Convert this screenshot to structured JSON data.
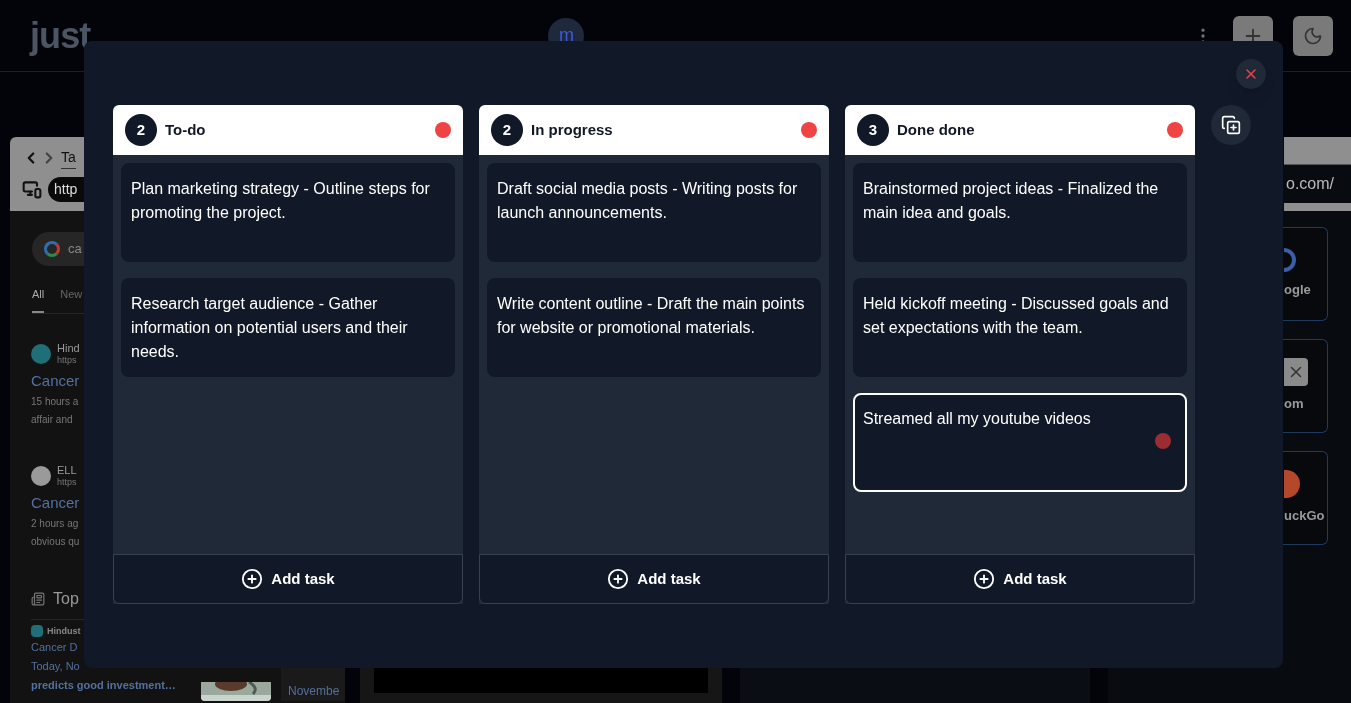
{
  "header": {
    "logo": [
      {
        "text": "just",
        "kind": "gray"
      }
    ],
    "avatar": "m"
  },
  "browser_preview": {
    "tab": "Ta",
    "url": "http",
    "search": "ca",
    "tabs": [
      {
        "label": "All",
        "selected": true
      },
      {
        "label": "New",
        "selected": false
      }
    ],
    "results": [
      {
        "color": "#1f6f78",
        "source": "Hind",
        "link": "https",
        "title": "Cancer",
        "meta": "15 hours a",
        "snippet": "affair and"
      },
      {
        "color": "#9a9a9a",
        "source": "ELL",
        "link": "https",
        "title": "Cancer",
        "meta": "2 hours ag",
        "snippet": "obvious qu"
      }
    ],
    "section": "Top",
    "story": {
      "source": "Hindust",
      "lines": [
        "Cancer D",
        "Today, No"
      ],
      "tail": "predicts good investment…"
    },
    "side_story": "Novembe"
  },
  "shortcuts": {
    "url": "o.com/",
    "tiles": [
      {
        "kind": "google",
        "label": "ogle"
      },
      {
        "kind": "x",
        "label": "om"
      },
      {
        "kind": "duck",
        "label": "uckGo"
      }
    ]
  },
  "board": {
    "columns": [
      {
        "count": "2",
        "title": "To-do",
        "add": "Add task",
        "tasks": [
          {
            "text": "Plan marketing strategy - Outline steps for promoting the project.",
            "selected": false
          },
          {
            "text": "Research target audience - Gather information on potential users and their needs.",
            "selected": false
          }
        ]
      },
      {
        "count": "2",
        "title": "In progress",
        "add": "Add task",
        "tasks": [
          {
            "text": "Draft social media posts - Writing posts for launch announcements.",
            "selected": false
          },
          {
            "text": "Write content outline - Draft the main points for website or promotional materials.",
            "selected": false
          }
        ]
      },
      {
        "count": "3",
        "title": "Done done",
        "add": "Add task",
        "tasks": [
          {
            "text": "Brainstormed project ideas - Finalized the main idea and goals.",
            "selected": false
          },
          {
            "text": "Held kickoff meeting - Discussed goals and set expectations with the team.",
            "selected": false
          },
          {
            "text": "Streamed all my youtube videos",
            "selected": true
          }
        ]
      }
    ]
  }
}
